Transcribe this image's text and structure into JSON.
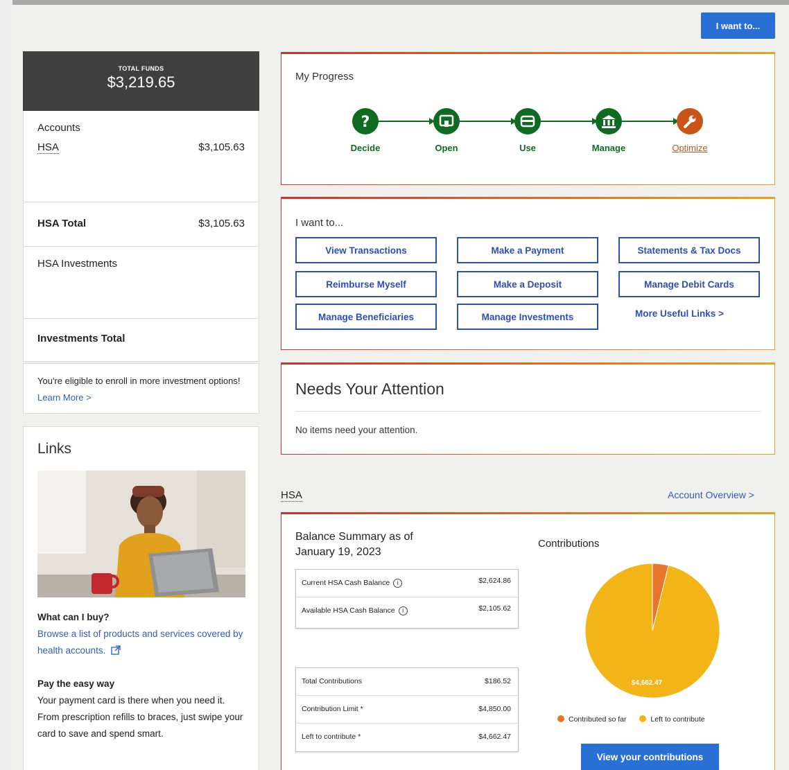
{
  "header": {
    "i_want_to_button": "I want to..."
  },
  "funds": {
    "label": "TOTAL FUNDS",
    "value": "$3,219.65"
  },
  "accounts": {
    "heading": "Accounts",
    "hsa_label": "HSA",
    "hsa_value": "$3,105.63",
    "hsa_total_label": "HSA Total",
    "hsa_total_value": "$3,105.63",
    "investments_label": "HSA Investments",
    "investments_total_label": "Investments Total"
  },
  "eligible": {
    "text": "You're eligible to enroll in more investment options!",
    "link": "Learn More >"
  },
  "links": {
    "title": "Links",
    "q1": "What can I buy?",
    "q1_link": "Browse a list of products and services covered by health accounts.",
    "q2": "Pay the easy way",
    "q2_text": "Your payment card is there when you need it. From prescription refills to braces, just swipe your card to save and spend smart."
  },
  "progress": {
    "title": "My Progress",
    "steps": [
      {
        "label": "Decide",
        "icon": "question-icon"
      },
      {
        "label": "Open",
        "icon": "card-reader-icon"
      },
      {
        "label": "Use",
        "icon": "card-icon"
      },
      {
        "label": "Manage",
        "icon": "bank-icon"
      },
      {
        "label": "Optimize",
        "icon": "wrench-icon"
      }
    ],
    "green": "#0e6b1f",
    "active_color": "#c9541a"
  },
  "iwant": {
    "title": "I want to...",
    "buttons": [
      "View Transactions",
      "Make a Payment",
      "Statements & Tax Docs",
      "Reimburse Myself",
      "Make a Deposit",
      "Manage Debit Cards",
      "Manage Beneficiaries",
      "Manage Investments"
    ],
    "more_link": "More Useful Links >"
  },
  "attention": {
    "title": "Needs Your Attention",
    "message": "No items need your attention."
  },
  "hsa": {
    "heading": "HSA",
    "overview_link": "Account Overview >",
    "balance_title_1": "Balance Summary as of",
    "balance_title_2": "January 19, 2023",
    "balances": [
      {
        "label": "Current HSA Cash Balance",
        "value": "$2,624.86"
      },
      {
        "label": "Available HSA Cash Balance",
        "value": "$2,105.62"
      }
    ],
    "contributions_table": [
      {
        "label": "Total Contributions",
        "value": "$186.52"
      },
      {
        "label": "Contribution Limit *",
        "value": "$4,850.00"
      },
      {
        "label": "Left to contribute *",
        "value": "$4,662.47"
      }
    ],
    "contributions_title": "Contributions",
    "legend_contributed": "Contributed so far",
    "legend_left": "Left to contribute",
    "view_button": "View your contributions",
    "color_contributed": "#e8762a",
    "color_left": "#f2b417"
  },
  "chart_data": {
    "type": "pie",
    "categories": [
      "Contributed so far",
      "Left to contribute"
    ],
    "values": [
      186.52,
      4662.47
    ],
    "data_labels": [
      "",
      "$4,662.47"
    ]
  }
}
